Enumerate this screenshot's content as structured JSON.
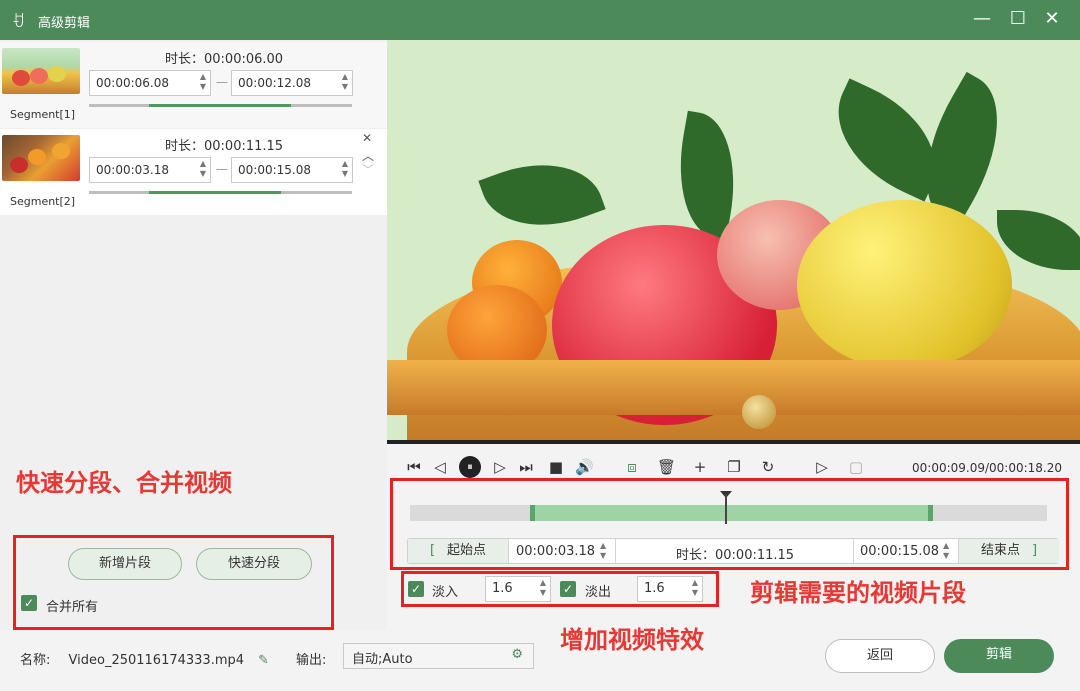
{
  "window": {
    "title": "高级剪辑",
    "logo_glyph": "ꀀ",
    "minimize": "—",
    "maximize": "☐",
    "close": "✕"
  },
  "segments": [
    {
      "label": "Segment[1]",
      "duration_label": "时长：00:00:06.00",
      "start": "00:00:06.08",
      "end": "00:00:12.08",
      "progress": 0.7
    },
    {
      "label": "Segment[2]",
      "duration_label": "时长：00:00:11.15",
      "start": "00:00:03.18",
      "end": "00:00:15.08",
      "progress": 0.65
    }
  ],
  "segment_controls": {
    "close": "✕",
    "up": "︿",
    "down": "﹀"
  },
  "range_separator": "—",
  "annotations": {
    "left": "快速分段、合并视频",
    "right": "剪辑需要的视频片段",
    "bottom": "增加视频特效"
  },
  "left_panel": {
    "add_segment": "新增片段",
    "quick_split": "快速分段",
    "merge_all": "合并所有"
  },
  "player": {
    "time_display": "00:00:09.09/00:00:18.20",
    "icons": [
      "⏮",
      "◁",
      "⏸",
      "▷",
      "⏭",
      "■",
      "🔊",
      "⧈",
      "🗑",
      "+",
      "❐",
      "↻",
      "▷",
      "▢"
    ]
  },
  "clip": {
    "start_label": "起始点",
    "start_time": "00:00:03.18",
    "duration_label": "时长：00:00:11.15",
    "end_time": "00:00:15.08",
    "end_label": "结束点",
    "bracket_left": "[",
    "bracket_right": "]"
  },
  "effects": {
    "fade_in_label": "淡入",
    "fade_in_value": "1.6",
    "fade_out_label": "淡出",
    "fade_out_value": "1.6"
  },
  "footer": {
    "name_label": "名称:",
    "filename": "Video_250116174333.mp4",
    "output_label": "输出:",
    "output_value": "自动;Auto",
    "back_button": "返回",
    "cut_button": "剪辑"
  },
  "colors": {
    "accent": "#4c8a5a",
    "annotation_red": "#e32222"
  }
}
